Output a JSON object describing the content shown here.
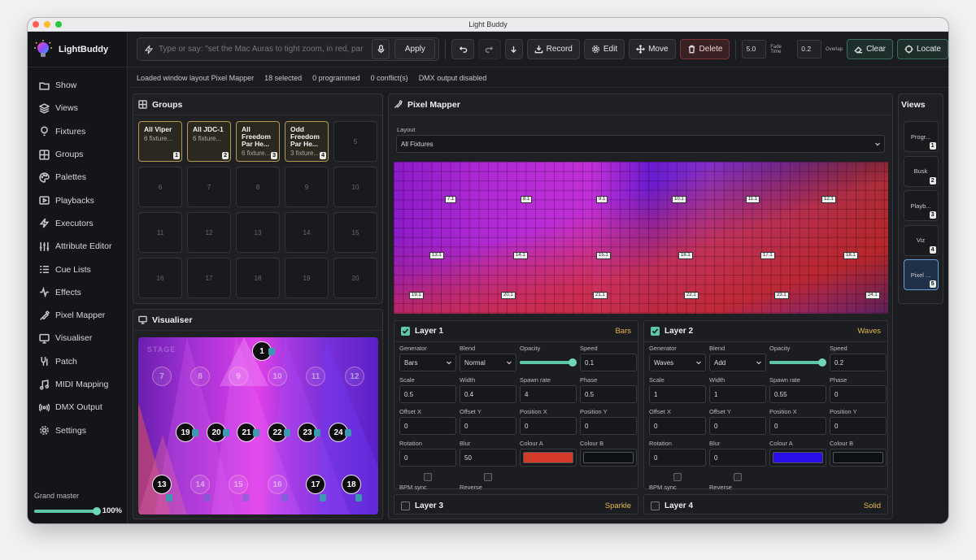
{
  "window": {
    "title": "Light Buddy"
  },
  "brand": {
    "name": "LightBuddy"
  },
  "nav": [
    {
      "label": "Show",
      "icon": "folder-icon"
    },
    {
      "label": "Views",
      "icon": "layers-icon"
    },
    {
      "label": "Fixtures",
      "icon": "bulb-icon"
    },
    {
      "label": "Groups",
      "icon": "grid-icon"
    },
    {
      "label": "Palettes",
      "icon": "palette-icon"
    },
    {
      "label": "Playbacks",
      "icon": "play-icon"
    },
    {
      "label": "Executors",
      "icon": "bolt-icon"
    },
    {
      "label": "Attribute Editor",
      "icon": "sliders-icon"
    },
    {
      "label": "Cue Lists",
      "icon": "list-icon"
    },
    {
      "label": "Effects",
      "icon": "pulse-icon"
    },
    {
      "label": "Pixel Mapper",
      "icon": "paint-icon"
    },
    {
      "label": "Visualiser",
      "icon": "monitor-icon"
    },
    {
      "label": "Patch",
      "icon": "patch-icon"
    },
    {
      "label": "MIDI Mapping",
      "icon": "music-icon"
    },
    {
      "label": "DMX Output",
      "icon": "broadcast-icon"
    },
    {
      "label": "Settings",
      "icon": "gear-icon"
    }
  ],
  "grand_master": {
    "label": "Grand master",
    "value": "100%",
    "level": 1.0
  },
  "toolbar": {
    "placeholder": "Type or say: \"set the Mac Auras to tight zoom, in red, par",
    "apply": "Apply",
    "record": "Record",
    "edit": "Edit",
    "move": "Move",
    "delete": "Delete",
    "fade_value": "5.0",
    "fade_label": "Fade Time",
    "overlap_value": "0.2",
    "overlap_label": "Overlap",
    "clear": "Clear",
    "locate": "Locate"
  },
  "status": [
    "Loaded window layout Pixel Mapper",
    "18 selected",
    "0 programmed",
    "0 conflict(s)",
    "DMX output disabled"
  ],
  "groups": {
    "title": "Groups",
    "active": [
      {
        "name": "All Viper",
        "sub": "6 fixture...",
        "num": "1"
      },
      {
        "name": "All JDC-1",
        "sub": "6 fixture...",
        "num": "2"
      },
      {
        "name": "All Freedom Par He...",
        "sub": "6 fixture...",
        "num": "3"
      },
      {
        "name": "Odd Freedom Par He...",
        "sub": "3 fixture...",
        "num": "4"
      }
    ],
    "empty": [
      "5",
      "6",
      "7",
      "8",
      "9",
      "10",
      "11",
      "12",
      "13",
      "14",
      "15",
      "16",
      "17",
      "18",
      "19",
      "20"
    ]
  },
  "visualiser": {
    "title": "Visualiser",
    "stage_label": "STAGE",
    "fixtures": [
      "1",
      "7",
      "8",
      "9",
      "10",
      "11",
      "12",
      "19",
      "20",
      "21",
      "22",
      "23",
      "24",
      "13",
      "14",
      "15",
      "16",
      "17",
      "18"
    ]
  },
  "mapper": {
    "title": "Pixel Mapper",
    "layout_label": "Layout",
    "layout_value": "All Fixtures",
    "labels": [
      "7.1",
      "8.1",
      "9.1",
      "10.1",
      "11.1",
      "12.1",
      "13.1",
      "14.1",
      "15.1",
      "16.1",
      "17.1",
      "18.1",
      "19.1",
      "20.1",
      "21.1",
      "22.1",
      "23.1",
      "24.1"
    ]
  },
  "views": {
    "title": "Views",
    "items": [
      {
        "label": "Progr...",
        "num": "1"
      },
      {
        "label": "Busk",
        "num": "2"
      },
      {
        "label": "Playb...",
        "num": "3"
      },
      {
        "label": "Viz",
        "num": "4"
      },
      {
        "label": "Pixel ...",
        "num": "5"
      }
    ]
  },
  "layers": [
    {
      "name": "Layer 1",
      "type": "Bars",
      "checked": true,
      "fields": {
        "generator": "Bars",
        "blend": "Normal",
        "opacity": 1.0,
        "speed": "0.1",
        "scale": "0.5",
        "width": "0.4",
        "spawn_rate": "4",
        "phase": "0.5",
        "offset_x": "0",
        "offset_y": "0",
        "position_x": "0",
        "position_y": "0",
        "rotation": "0",
        "blur": "50"
      },
      "colour_a": "#d43a2a",
      "colour_b": "#0d1114"
    },
    {
      "name": "Layer 2",
      "type": "Waves",
      "checked": true,
      "fields": {
        "generator": "Waves",
        "blend": "Add",
        "opacity": 1.0,
        "speed": "0.2",
        "scale": "1",
        "width": "1",
        "spawn_rate": "0.55",
        "phase": "0",
        "offset_x": "0",
        "offset_y": "0",
        "position_x": "0",
        "position_y": "0",
        "rotation": "0",
        "blur": "0"
      },
      "colour_a": "#2a10e8",
      "colour_b": "#0d1114"
    },
    {
      "name": "Layer 3",
      "type": "Sparkle",
      "checked": false
    },
    {
      "name": "Layer 4",
      "type": "Solid",
      "checked": false
    }
  ],
  "field_labels": {
    "generator": "Generator",
    "blend": "Blend",
    "opacity": "Opacity",
    "speed": "Speed",
    "scale": "Scale",
    "width": "Width",
    "spawn_rate": "Spawn rate",
    "phase": "Phase",
    "offset_x": "Offset X",
    "offset_y": "Offset Y",
    "position_x": "Position X",
    "position_y": "Position Y",
    "rotation": "Rotation",
    "blur": "Blur",
    "colour_a": "Colour A",
    "colour_b": "Colour B",
    "bpm_sync": "BPM sync",
    "reverse": "Reverse"
  },
  "colors": {
    "accent_teal": "#5fc6a8",
    "group_gold": "#b59a4e",
    "layer_gold": "#e5b848",
    "check_green": "#5fc6a8"
  }
}
